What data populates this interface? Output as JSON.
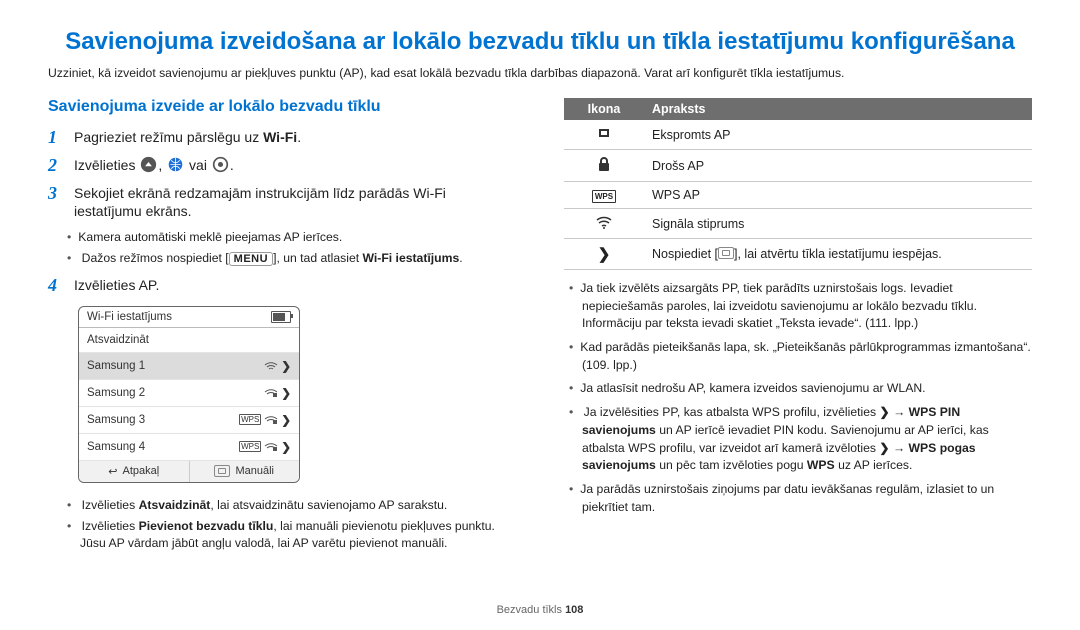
{
  "title": "Savienojuma izveidošana ar lokālo bezvadu tīklu un tīkla iestatījumu konfigurēšana",
  "intro": "Uzziniet, kā izveidot savienojumu ar piekļuves punktu (AP), kad esat lokālā bezvadu tīkla darbības diapazonā. Varat arī konfigurēt tīkla iestatījumus.",
  "left": {
    "subtitle": "Savienojuma izveide ar lokālo bezvadu tīklu",
    "step1_prefix": "Pagrieziet režīmu pārslēgu uz ",
    "step1_wifi": "Wi-Fi",
    "step1_suffix": ".",
    "step2_prefix": "Izvēlieties ",
    "step2_or": "vai",
    "step2_suffix": ".",
    "step3": "Sekojiet ekrānā redzamajām instrukcijām līdz parādās Wi-Fi iestatījumu ekrāns.",
    "step3_b1": "Kamera automātiski meklē pieejamas AP ierīces.",
    "step3_b2_a": "Dažos režīmos nospiediet [",
    "step3_b2_key": "MENU",
    "step3_b2_b": "], un tad atlasiet ",
    "step3_b2_bold": "Wi-Fi iestatījums",
    "step3_b2_c": ".",
    "step4": "Izvēlieties AP.",
    "panel_head": "Wi-Fi iestatījums",
    "panel_refresh": "Atsvaidzināt",
    "panel_s1": "Samsung 1",
    "panel_s2": "Samsung 2",
    "panel_s3": "Samsung 3",
    "panel_s4": "Samsung 4",
    "panel_back": "Atpakaļ",
    "panel_manual": "Manuāli",
    "afterpanel_b1_a": "Izvēlieties ",
    "afterpanel_b1_bold": "Atsvaidzināt",
    "afterpanel_b1_b": ", lai atsvaidzinātu savienojamo AP sarakstu.",
    "afterpanel_b2_a": "Izvēlieties ",
    "afterpanel_b2_bold": "Pievienot bezvadu tīklu",
    "afterpanel_b2_b": ", lai manuāli pievienotu piekļuves punktu. Jūsu AP vārdam jābūt angļu valodā, lai AP varētu pievienot manuāli."
  },
  "right": {
    "th1": "Ikona",
    "th2": "Apraksts",
    "r1": "Ekspromts AP",
    "r2": "Drošs AP",
    "r3": "WPS AP",
    "r4": "Signāla stiprums",
    "r5_a": "Nospiediet [",
    "r5_b": "], lai atvērtu tīkla iestatījumu iespējas.",
    "b1": "Ja tiek izvēlēts aizsargāts PP, tiek parādīts uznirstošais logs. Ievadiet nepieciešamās paroles, lai izveidotu savienojumu ar lokālo bezvadu tīklu. Informāciju par teksta ievadi skatiet „Teksta ievade“. (111. lpp.)",
    "b2": "Kad parādās pieteikšanās lapa, sk. „Pieteikšanās pārlūkprogrammas izmantošana“. (109. lpp.)",
    "b3": "Ja atlasīsit nedrošu AP, kamera izveidos savienojumu ar WLAN.",
    "b4_a": "Ja izvēlēsities PP, kas atbalsta WPS profilu, izvēlieties ",
    "b4_arrow": "❯",
    "b4_b": " → ",
    "b4_bold1": "WPS PIN savienojums",
    "b4_c": " un AP ierīcē ievadiet PIN kodu. Savienojumu ar AP ierīci, kas atbalsta WPS profilu, var izveidot arī kamerā izvēloties ",
    "b4_bold2": "WPS pogas savienojums",
    "b4_d": " un pēc tam izvēloties pogu ",
    "b4_bold3": "WPS",
    "b4_e": " uz AP ierīces.",
    "b5": "Ja parādās uznirstošais ziņojums par datu ievākšanas regulām, izlasiet to un piekrītiet tam."
  },
  "footer_a": "Bezvadu tīkls  ",
  "footer_b": "108"
}
